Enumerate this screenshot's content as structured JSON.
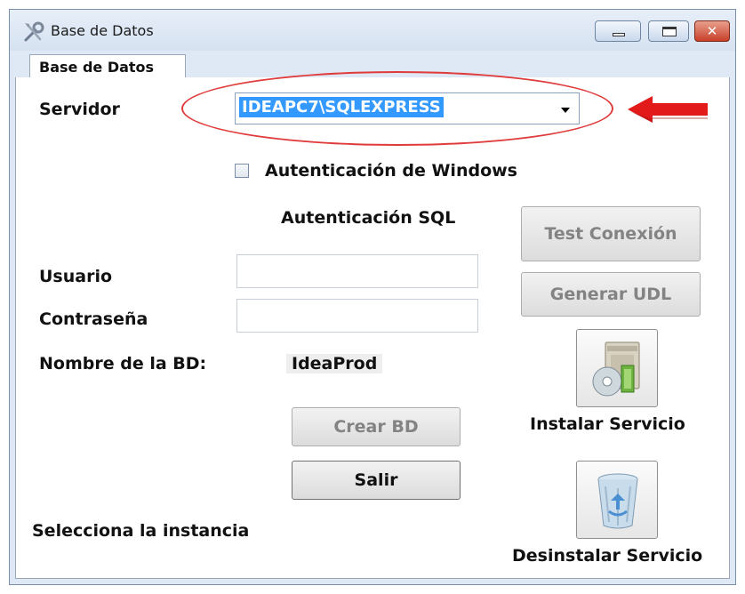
{
  "window": {
    "title": "Base de Datos",
    "title_icon": "tools-icon",
    "close_glyph": "✕"
  },
  "tab": {
    "label": "Base de Datos"
  },
  "form": {
    "servidor_label": "Servidor",
    "servidor_value": "IDEAPC7\\SQLEXPRESS",
    "windows_auth_label": "Autenticación de Windows",
    "windows_auth_checked": false,
    "sql_auth_heading": "Autenticación SQL",
    "usuario_label": "Usuario",
    "usuario_value": "",
    "contrasena_label": "Contraseña",
    "contrasena_value": "",
    "db_name_label": "Nombre de la BD:",
    "db_name_value": "IdeaProd",
    "hint": "Selecciona la instancia"
  },
  "buttons": {
    "test_conexion": "Test Conexión",
    "generar_udl": "Generar UDL",
    "crear_bd": "Crear BD",
    "salir": "Salir",
    "instalar_servicio": "Instalar Servicio",
    "desinstalar_servicio": "Desinstalar Servicio"
  },
  "annotations": {
    "highlight_color": "#e03b3b",
    "arrow_color": "#e21a1a"
  },
  "colors": {
    "selection": "#3399ff",
    "window_frame": "#dfe9f5"
  }
}
